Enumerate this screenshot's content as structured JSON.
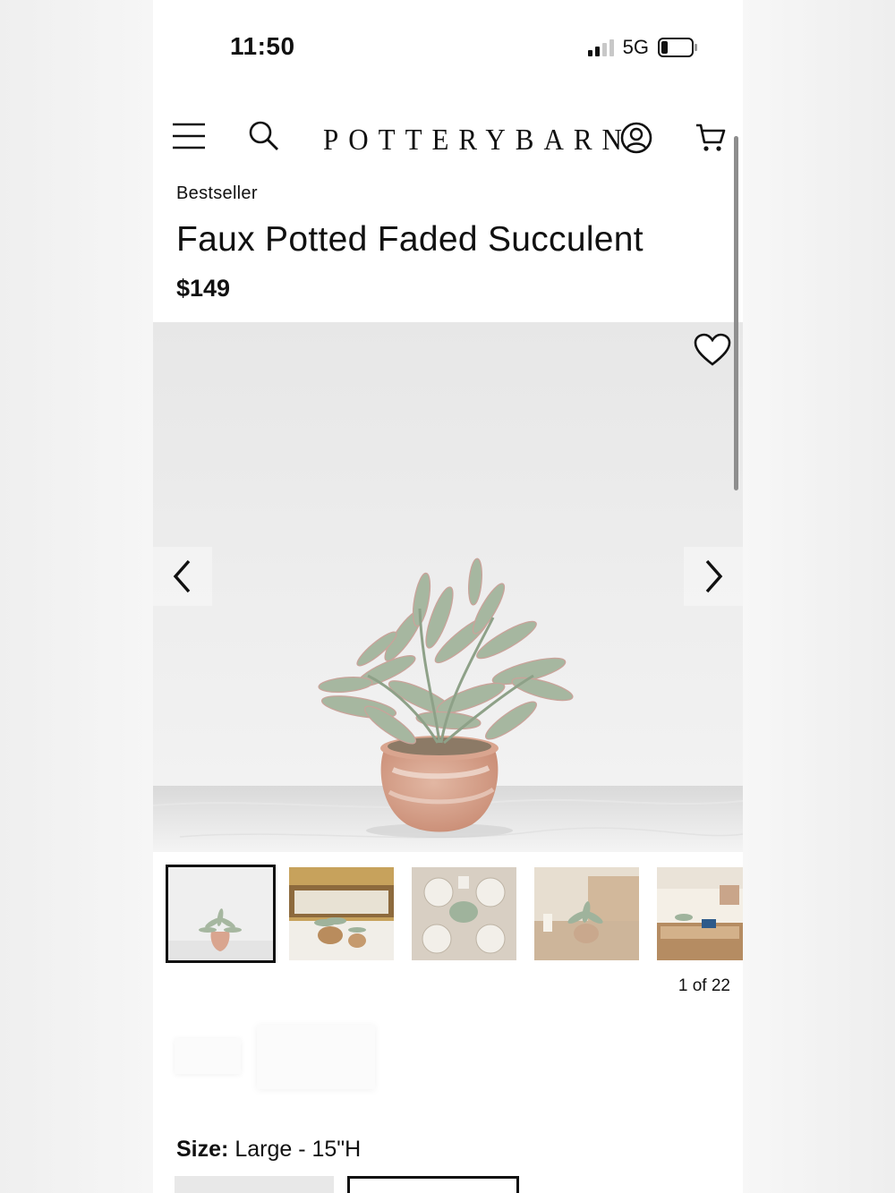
{
  "status_bar": {
    "time": "11:50",
    "network": "5G"
  },
  "header": {
    "logo": "POTTERYBARN",
    "icons": [
      "menu-icon",
      "search-icon",
      "account-icon",
      "cart-icon"
    ]
  },
  "product": {
    "badge": "Bestseller",
    "title": "Faux Potted Faded Succulent",
    "price": "$149"
  },
  "gallery": {
    "counter": "1 of 22",
    "thumbnails": [
      {
        "name": "thumb-1-succulent-white",
        "active": true
      },
      {
        "name": "thumb-2-living-room",
        "active": false
      },
      {
        "name": "thumb-3-tablesetting",
        "active": false
      },
      {
        "name": "thumb-4-sofa-table",
        "active": false
      },
      {
        "name": "thumb-5-coffee-table",
        "active": false
      }
    ]
  },
  "size": {
    "label": "Size:",
    "value": "Large - 15\"H"
  },
  "colors": {
    "accent": "#111111",
    "pot": "#d9a58f",
    "leaf": "#9fb39c"
  }
}
